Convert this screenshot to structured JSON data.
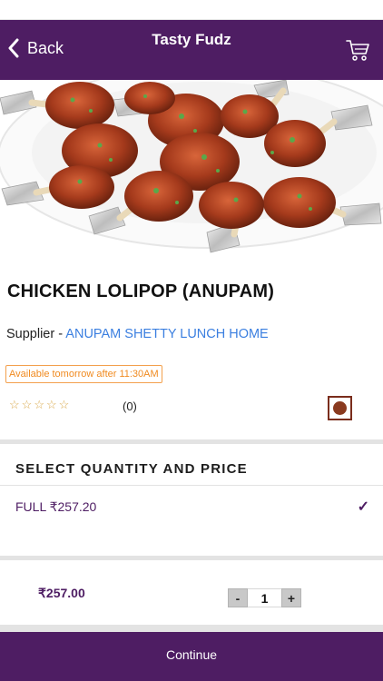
{
  "nav": {
    "back_label": "Back",
    "title": "Tasty Fudz",
    "back_icon": "chevron-left-icon",
    "cart_icon": "cart-icon"
  },
  "product": {
    "name": "CHICKEN LOLIPOP (ANUPAM)",
    "supplier_prefix": "Supplier - ",
    "supplier_name": "ANUPAM SHETTY LUNCH HOME",
    "availability": "Available tomorrow after 11:30AM",
    "rating_stars": [
      "☆",
      "☆",
      "☆",
      "☆",
      "☆"
    ],
    "rating_count": "(0)",
    "diet_icon": "non-veg-icon"
  },
  "quantity": {
    "heading": "SELECT QUANTITY AND PRICE",
    "options": [
      {
        "label": "FULL ₹257.20",
        "selected": true
      }
    ],
    "check_glyph": "✓"
  },
  "cart": {
    "total": "₹257.00",
    "minus": "-",
    "qty": "1",
    "plus": "+"
  },
  "footer": {
    "continue_label": "Continue"
  },
  "colors": {
    "brand": "#4e1d63",
    "link": "#3b7fe0",
    "badge": "#f08a1f",
    "nonveg": "#8a3a1f"
  }
}
